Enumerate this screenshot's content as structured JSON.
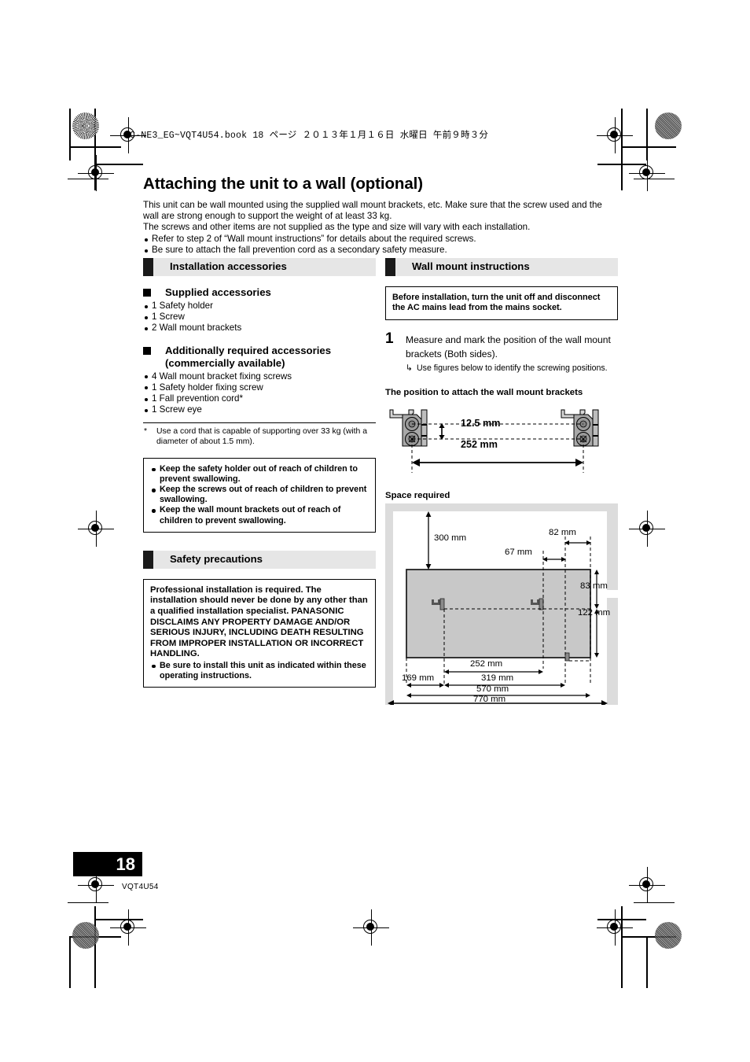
{
  "header": {
    "book_line": "SC-NE3_EG~VQT4U54.book   18 ページ   ２０１３年１月１６日   水曜日   午前９時３分"
  },
  "page": {
    "title": "Attaching the unit to a wall (optional)",
    "intro": {
      "p1": "This unit can be wall mounted using the supplied wall mount brackets, etc. Make sure that the screw used and the wall are strong enough to support the weight of at least 33 kg.",
      "p2": "The screws and other items are not supplied as the type and size will vary with each installation.",
      "b1": "Refer to step 2 of “Wall mount instructions” for details about the required screws.",
      "b2": "Be sure to attach the fall prevention cord as a secondary safety measure."
    },
    "page_number": "18",
    "doc_code": "VQT4U54"
  },
  "left": {
    "section_installation": "Installation accessories",
    "supplied_heading": "Supplied accessories",
    "supplied_items": [
      "1 Safety holder",
      "1 Screw",
      "2 Wall mount brackets"
    ],
    "additional_heading_l1": "Additionally required accessories",
    "additional_heading_l2": "(commercially available)",
    "additional_items": [
      "4 Wall mount bracket fixing screws",
      "1 Safety holder fixing screw",
      "1 Fall prevention cord*",
      "1 Screw eye"
    ],
    "footnote_star": "*",
    "footnote_text": "Use a cord that is capable of supporting over 33 kg (with a diameter of about 1.5 mm).",
    "child_warnings": [
      "Keep the safety holder out of reach of children to prevent swallowing.",
      "Keep the screws out of reach of children to prevent swallowing.",
      "Keep the wall mount brackets out of reach of children to prevent swallowing."
    ],
    "section_safety": "Safety precautions",
    "safety_paragraph": "Professional installation is required. The installation should never be done by any other than a qualified installation specialist. PANASONIC DISCLAIMS ANY PROPERTY DAMAGE AND/OR SERIOUS INJURY, INCLUDING DEATH RESULTING FROM IMPROPER INSTALLATION OR INCORRECT HANDLING.",
    "safety_bullet": "Be sure to install this unit as indicated within these operating instructions."
  },
  "right": {
    "section_wallmount": "Wall mount instructions",
    "notice": "Before installation, turn the unit off and disconnect the AC mains lead from the mains socket.",
    "step1_num": "1",
    "step1_text": "Measure and mark the position of the wall mount brackets (Both sides).",
    "step1_sub_arrow": "↳",
    "step1_sub": "Use figures below to identify the screwing positions.",
    "fig1_caption": "The position to attach the wall mount brackets",
    "fig1_dim_vertical": "12.5 mm",
    "fig1_dim_horizontal": "252 mm",
    "fig2_caption": "Space required",
    "fig2_dims": {
      "top_clearance": "300 mm",
      "right_inner": "67 mm",
      "right_outer": "82 mm",
      "upper_height": "83 mm",
      "lower_height": "122 mm",
      "bracket_span": "252 mm",
      "left_offset": "169 mm",
      "mid_span": "319 mm",
      "total_inner": "570 mm",
      "total_outer": "770 mm"
    }
  }
}
